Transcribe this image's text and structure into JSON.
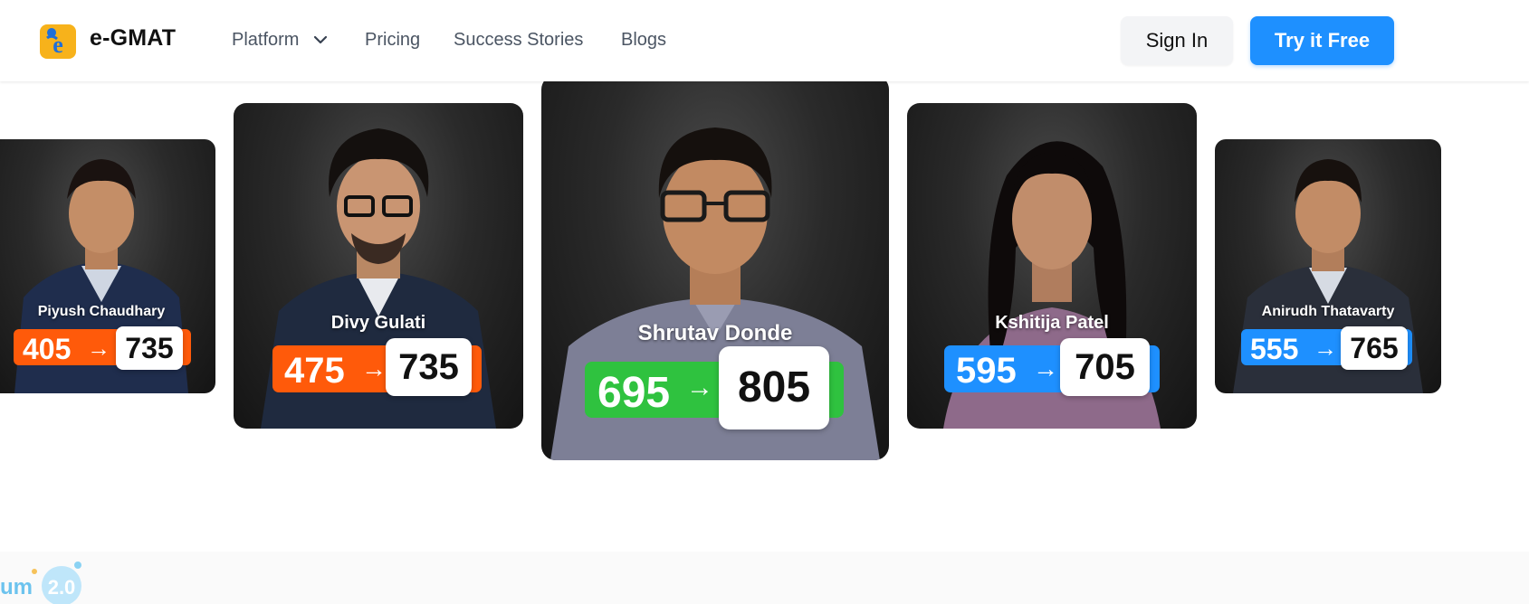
{
  "header": {
    "brand": "e-GMAT",
    "nav": {
      "platform": "Platform",
      "pricing": "Pricing",
      "success_stories": "Success Stories",
      "blogs": "Blogs"
    },
    "sign_in": "Sign In",
    "try_free": "Try it Free"
  },
  "success_stories": [
    {
      "name": "Piyush Chaudhary",
      "before": "405",
      "after": "735",
      "color": "#ff5a0a"
    },
    {
      "name": "Divy Gulati",
      "before": "475",
      "after": "735",
      "color": "#ff5a0a"
    },
    {
      "name": "Shrutav Donde",
      "before": "695",
      "after": "805",
      "color": "#2fc23f"
    },
    {
      "name": "Kshitija Patel",
      "before": "595",
      "after": "705",
      "color": "#1e90ff"
    },
    {
      "name": "Anirudh Thatavarty",
      "before": "555",
      "after": "765",
      "color": "#1e90ff"
    }
  ],
  "arrow": "→",
  "footer_logo": {
    "text_fragment": "um",
    "version": "2.0"
  },
  "colors": {
    "accent": "#1e90ff",
    "orange": "#ff5a0a",
    "green": "#2fc23f"
  }
}
